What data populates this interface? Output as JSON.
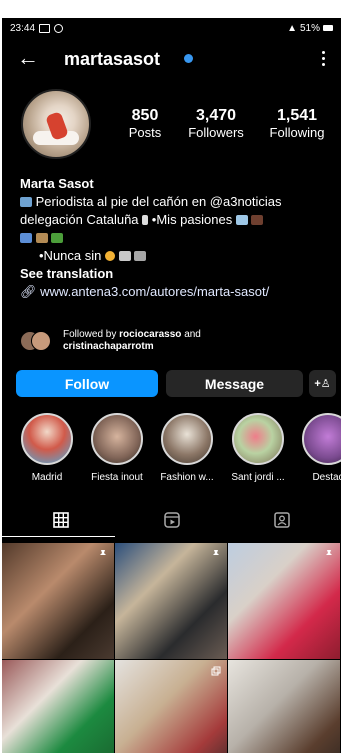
{
  "status_bar": {
    "time": "23:44",
    "right": "51%"
  },
  "profile": {
    "username": "martasasot",
    "stats": [
      {
        "value": "850",
        "label": "Posts"
      },
      {
        "value": "3,470",
        "label": "Followers"
      },
      {
        "value": "1,541",
        "label": "Following"
      }
    ],
    "name": "Marta Sasot",
    "bio_lines": [
      "Periodista al pie del cañón en @a3noticias",
      "delegación Cataluña",
      "•Mis pasiones",
      "•Nunca sin"
    ],
    "see_translation": "See translation",
    "link": "www.antena3.com/autores/marta-sasot/",
    "followed_by_prefix": "Followed by",
    "followed_by_name1": "rociocarasso",
    "followed_by_and": "and",
    "followed_by_name2": "cristinachaparrotm"
  },
  "buttons": {
    "follow": "Follow",
    "message": "Message"
  },
  "highlights": [
    {
      "label": "Madrid"
    },
    {
      "label": "Fiesta inout"
    },
    {
      "label": "Fashion w..."
    },
    {
      "label": "Sant jordi ..."
    },
    {
      "label": "Destac"
    }
  ],
  "colors": {
    "accent": "#0a95ff",
    "verified": "#3897f0"
  },
  "icons": {
    "grid": "grid-icon",
    "reels": "reels-icon",
    "tagged": "tagged-icon",
    "back": "back-arrow-icon",
    "more": "more-vertical-icon",
    "add_user": "add-user-icon"
  }
}
